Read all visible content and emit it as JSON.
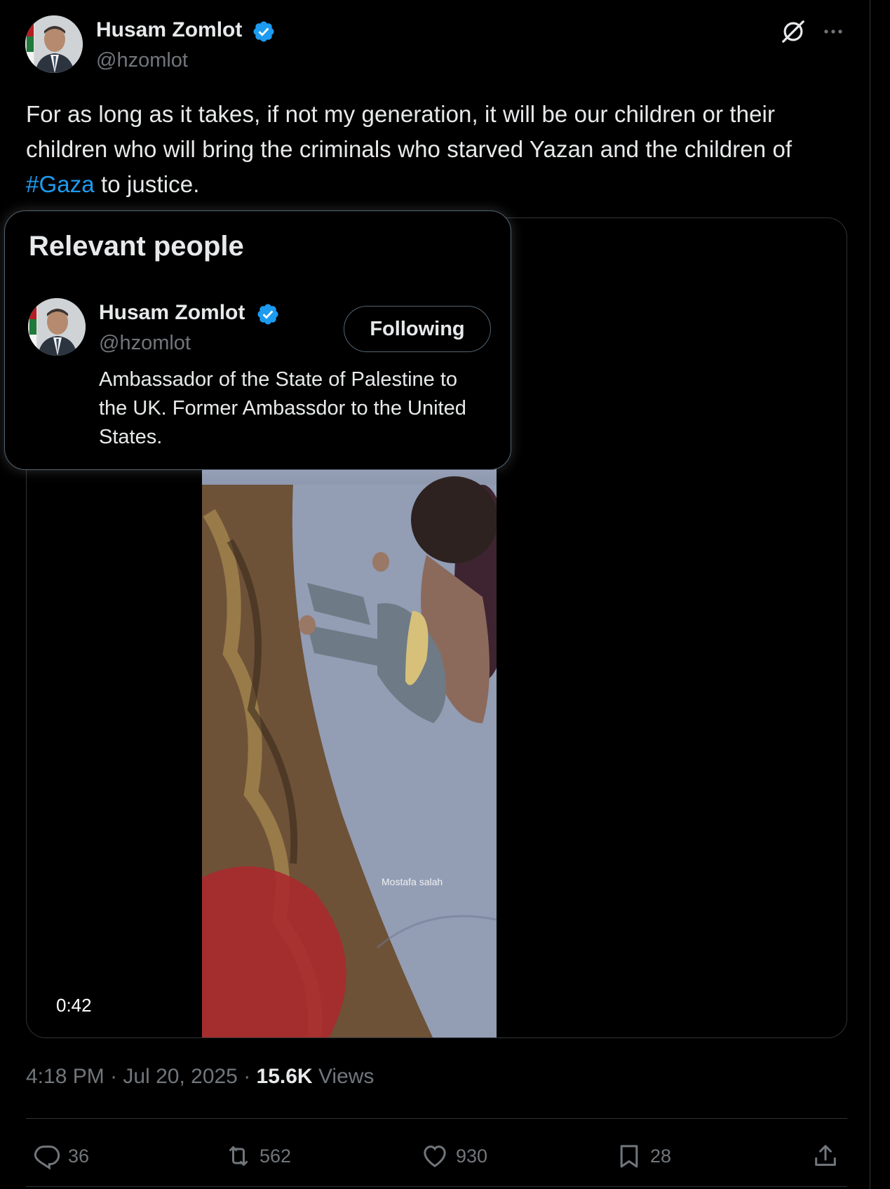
{
  "post": {
    "author_name": "Husam Zomlot",
    "author_handle": "@hzomlot",
    "text_before": "For as long as it takes, if not my generation, it will be our children or their children who will bring the criminals who starved Yazan and the children of ",
    "hashtag": "#Gaza",
    "text_after": " to justice.",
    "video_duration": "0:42",
    "video_watermark": "Mostafa salah",
    "time": "4:18 PM",
    "separator": " · ",
    "date": "Jul 20, 2025",
    "views_count": "15.6K",
    "views_label": "Views"
  },
  "relevant_people": {
    "title": "Relevant people",
    "name": "Husam Zomlot",
    "handle": "@hzomlot",
    "button_label": "Following",
    "bio": "Ambassador of the State of Palestine to the UK. Former Ambassdor to the United States."
  },
  "actions": {
    "replies": "36",
    "reposts": "562",
    "likes": "930",
    "bookmarks": "28"
  },
  "colors": {
    "background": "#000000",
    "text": "#e7e9ea",
    "muted": "#71767b",
    "link": "#1d9bf0",
    "border": "#2f3336"
  },
  "icons": [
    "verified-badge-icon",
    "grok-icon",
    "more-icon",
    "reply-icon",
    "repost-icon",
    "like-icon",
    "bookmark-icon",
    "share-icon"
  ]
}
